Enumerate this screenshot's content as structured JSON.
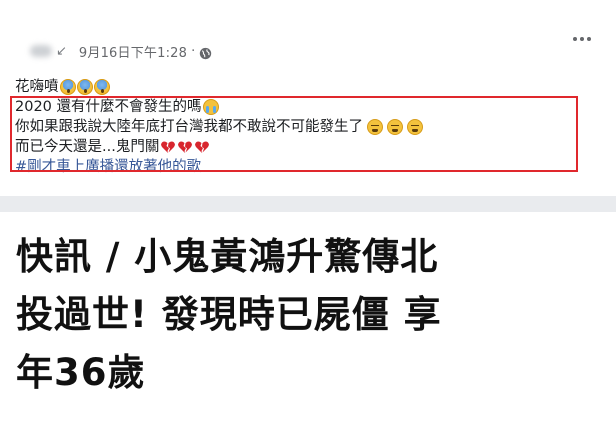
{
  "post": {
    "timestamp": "9月16日下午1:28",
    "separator": "·",
    "author_mark": "↙",
    "privacy_icon": "globe-icon",
    "more_icon": "more-dots-icon",
    "lines": [
      {
        "text": "花嗨噴",
        "emojis": [
          "scream-emoji",
          "scream-emoji",
          "scream-emoji"
        ]
      },
      {
        "text": "2020 還有什麼不會發生的嗎",
        "emojis": [
          "crying-emoji"
        ]
      },
      {
        "text": "你如果跟我說大陸年底打台灣我都不敢說不可能發生了",
        "emojis": [
          "weary-emoji",
          "weary-emoji",
          "weary-emoji"
        ]
      },
      {
        "text": "而已今天還是...鬼門關",
        "emojis": [
          "broken-heart",
          "broken-heart",
          "broken-heart"
        ]
      }
    ],
    "hashtag": "#剛才車上廣播還放著他的歌",
    "highlight_color": "#e0282d",
    "link_color": "#385898"
  },
  "article": {
    "headline_lines": [
      "快訊 / 小鬼黃鴻升驚傳北",
      "投過世! 發現時已屍僵 享",
      "年36歲"
    ]
  }
}
